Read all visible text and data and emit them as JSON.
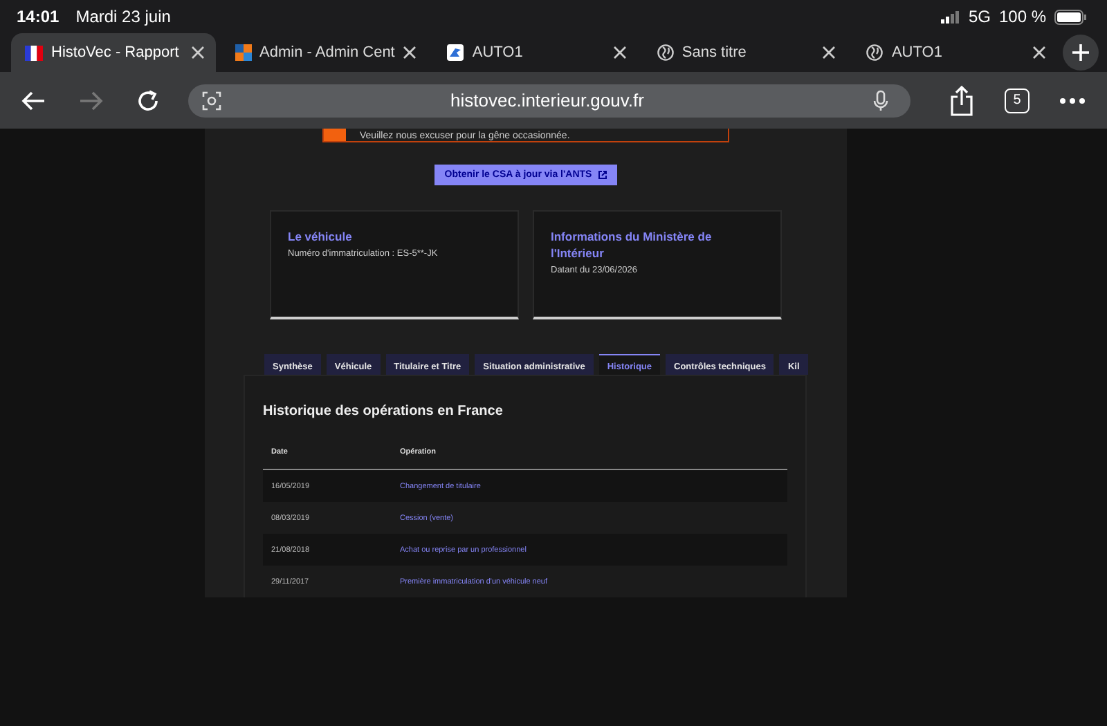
{
  "status_bar": {
    "time": "14:01",
    "date": "Mardi 23 juin",
    "network": "5G",
    "battery": "100 %"
  },
  "browser_tabs": [
    {
      "title": "HistoVec - Rapport",
      "kind": "flag",
      "selected": true
    },
    {
      "title": "Admin - Admin Cent",
      "kind": "squares",
      "selected": false
    },
    {
      "title": "AUTO1",
      "kind": "app",
      "selected": false
    },
    {
      "title": "Sans titre",
      "kind": "globe",
      "selected": false
    },
    {
      "title": "AUTO1",
      "kind": "globe",
      "selected": false
    }
  ],
  "toolbar": {
    "url": "histovec.interieur.gouv.fr",
    "tab_count": "5",
    "forward_disabled": true
  },
  "page": {
    "banner": {
      "text": "Veuillez nous excuser pour la gêne occasionnée."
    },
    "csa_button": "Obtenir le CSA à jour via l'ANTS",
    "cards": [
      {
        "title": "Le véhicule",
        "text": "Numéro d'immatriculation : ES-5**-JK"
      },
      {
        "title": "Informations du Ministère de l'Intérieur",
        "text": "Datant du 23/06/2026"
      }
    ],
    "tabs": [
      {
        "label": "Synthèse",
        "selected": false
      },
      {
        "label": "Véhicule",
        "selected": false
      },
      {
        "label": "Titulaire et Titre",
        "selected": false
      },
      {
        "label": "Situation administrative",
        "selected": false
      },
      {
        "label": "Historique",
        "selected": true
      },
      {
        "label": "Contrôles techniques",
        "selected": false
      },
      {
        "label": "Kil",
        "selected": false
      }
    ],
    "panel": {
      "title": "Historique des opérations en France",
      "table": {
        "columns": [
          "Date",
          "Opération"
        ],
        "rows": [
          [
            "16/05/2019",
            "Changement de titulaire"
          ],
          [
            "08/03/2019",
            "Cession (vente)"
          ],
          [
            "21/08/2018",
            "Achat ou reprise par un professionnel"
          ],
          [
            "29/11/2017",
            "Première immatriculation d'un véhicule neuf"
          ]
        ]
      }
    }
  }
}
